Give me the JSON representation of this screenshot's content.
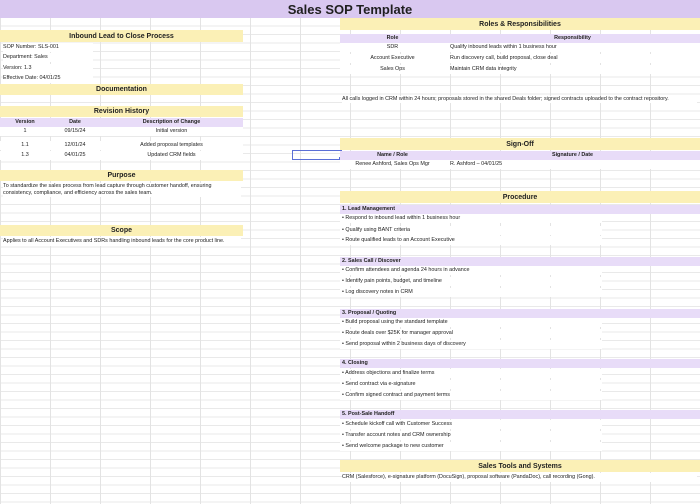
{
  "title": "Sales SOP Template",
  "left": {
    "section_title": "Inbound Lead to Close Process",
    "meta": [
      "SOP Number: SLS-001",
      "Department: Sales",
      "Version: 1.3",
      "Effective Date: 04/01/25"
    ],
    "documentation_title": "Documentation",
    "revision_title": "Revision History",
    "revision_headers": [
      "Version",
      "Date",
      "Description of Change"
    ],
    "revisions": [
      [
        "1",
        "09/15/24",
        "Initial version"
      ],
      [
        "1.1",
        "12/01/24",
        "Added proposal templates"
      ],
      [
        "1.3",
        "04/01/25",
        "Updated CRM fields"
      ]
    ],
    "purpose_title": "Purpose",
    "purpose_text": "To standardize the sales process from lead capture through customer handoff, ensuring consistency, compliance, and efficiency across the sales team.",
    "scope_title": "Scope",
    "scope_text": "Applies to all Account Executives and SDRs handling inbound leads for the core product line."
  },
  "right": {
    "roles_title": "Roles & Responsibilities",
    "roles_headers": [
      "Role",
      "Responsibility"
    ],
    "roles": [
      [
        "SDR",
        "Qualify inbound leads within 1 business hour"
      ],
      [
        "Account Executive",
        "Run discovery call, build proposal, close deal"
      ],
      [
        "Sales Ops",
        "Maintain CRM data integrity"
      ]
    ],
    "records_text": "All calls logged in CRM within 24 hours; proposals stored in the shared Deals folder; signed contracts uploaded to the contract repository.",
    "signoff_title": "Sign-Off",
    "signoff_headers": [
      "Name / Role",
      "Signature / Date"
    ],
    "signoff_row": [
      "Renee Ashford, Sales Ops Mgr",
      "R. Ashford – 04/01/25"
    ],
    "procedure_title": "Procedure",
    "steps": [
      {
        "title": "1. Lead Management",
        "items": [
          "Respond to inbound lead within 1 business hour",
          "Qualify using BANT criteria",
          "Route qualified leads to an Account Executive"
        ]
      },
      {
        "title": "2. Sales Call / Discover",
        "items": [
          "Confirm attendees and agenda 24 hours in advance",
          "Identify pain points, budget, and timeline",
          "Log discovery notes in CRM"
        ]
      },
      {
        "title": "3. Proposal / Quoting",
        "items": [
          "Build proposal using the standard template",
          "Route deals over $25K for manager approval",
          "Send proposal within 2 business days of discovery"
        ]
      },
      {
        "title": "4. Closing",
        "items": [
          "Address objections and finalize terms",
          "Send contract via e-signature",
          "Confirm signed contract and payment terms"
        ]
      },
      {
        "title": "5. Post-Sale Handoff",
        "items": [
          "Schedule kickoff call with Customer Success",
          "Transfer account notes and CRM ownership",
          "Send welcome package to new customer"
        ]
      }
    ],
    "tools_title": "Sales Tools and Systems",
    "tools_text": "CRM (Salesforce), e-signature platform (DocuSign), proposal software (PandaDoc), call recording (Gong)."
  }
}
